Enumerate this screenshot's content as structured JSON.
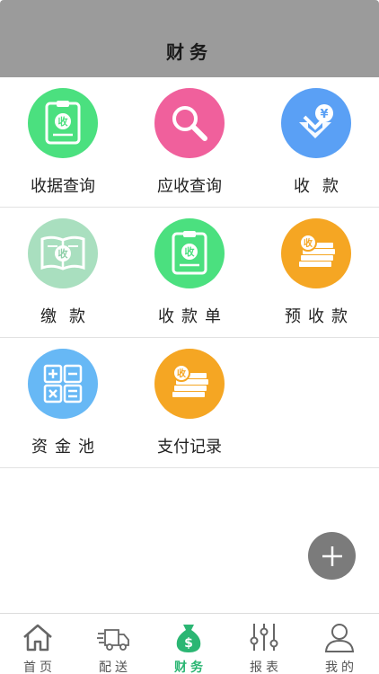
{
  "header": {
    "title": "财务"
  },
  "grid": {
    "items": [
      {
        "label": "收据查询",
        "color": "#4be07f",
        "icon": "receipt-icon"
      },
      {
        "label": "应收查询",
        "color": "#f0609c",
        "icon": "search-icon"
      },
      {
        "label": "收款",
        "color": "#5aa0f5",
        "icon": "yen-receive-icon"
      },
      {
        "label": "缴款",
        "color": "#a9dfbf",
        "icon": "book-payment-icon"
      },
      {
        "label": "收款单",
        "color": "#4be07f",
        "icon": "receipt-icon"
      },
      {
        "label": "预收款",
        "color": "#f5a623",
        "icon": "cash-stack-icon"
      },
      {
        "label": "资金池",
        "color": "#67b8f5",
        "icon": "calculator-icon"
      },
      {
        "label": "支付记录",
        "color": "#f5a623",
        "icon": "cash-stack-icon"
      }
    ]
  },
  "fab": {
    "icon": "plus-icon",
    "color": "#7b7b7b"
  },
  "tabs": [
    {
      "label": "首页",
      "icon": "home-icon"
    },
    {
      "label": "配送",
      "icon": "delivery-truck-icon"
    },
    {
      "label": "财务",
      "icon": "money-bag-icon",
      "active": true,
      "color": "#2bb673"
    },
    {
      "label": "报表",
      "icon": "sliders-icon"
    },
    {
      "label": "我的",
      "icon": "user-icon"
    }
  ]
}
